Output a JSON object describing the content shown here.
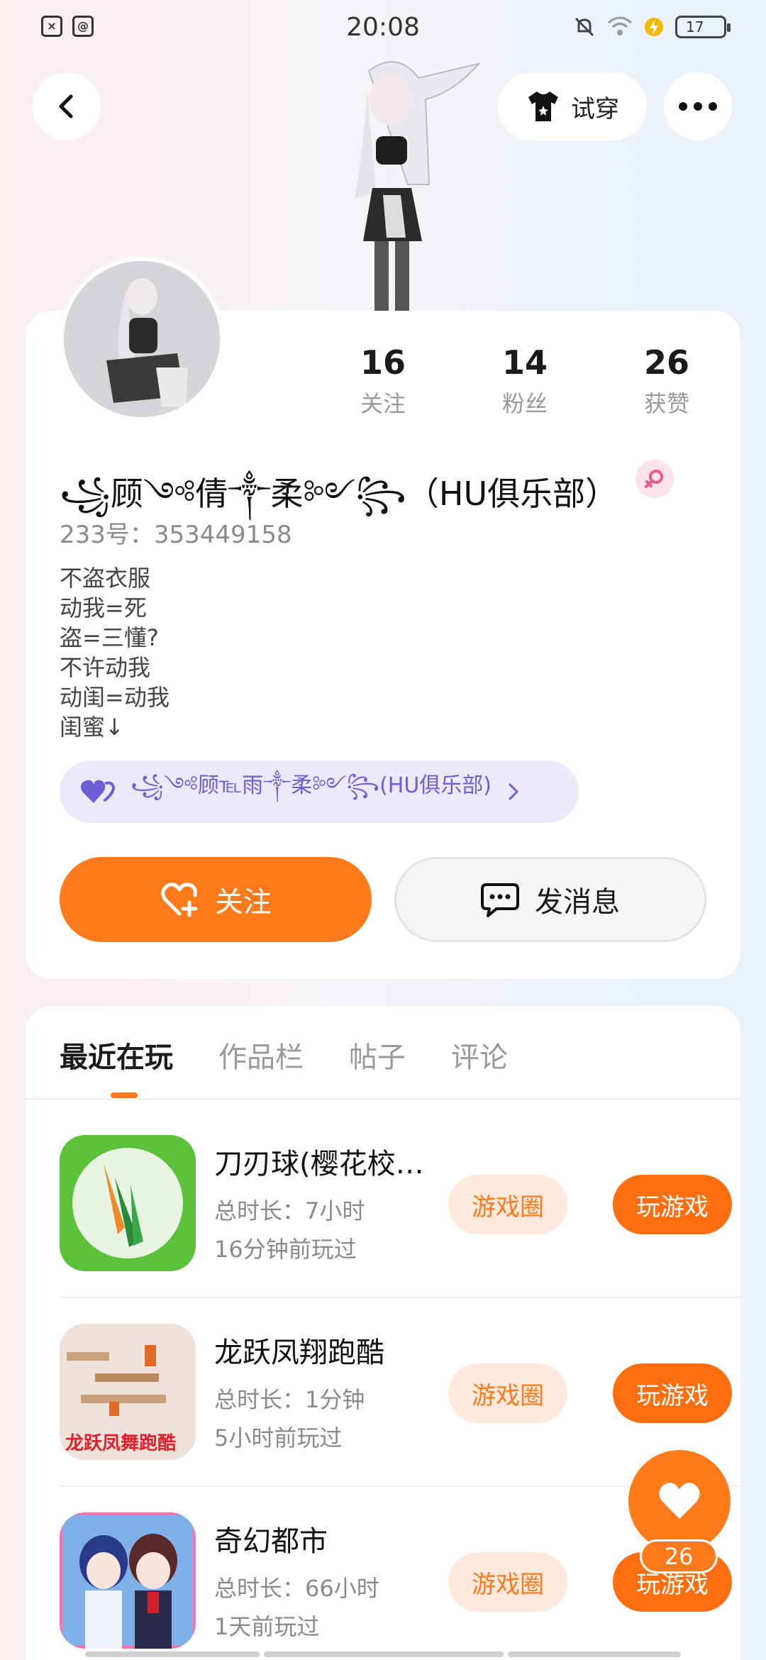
{
  "status_bar": {
    "time": "20:08",
    "battery": "17",
    "left_icon_2": "@"
  },
  "header": {
    "tryon_label": "试穿"
  },
  "profile": {
    "stats": [
      {
        "value": "16",
        "label": "关注"
      },
      {
        "value": "14",
        "label": "粉丝"
      },
      {
        "value": "26",
        "label": "获赞"
      }
    ],
    "nickname": "꧁顾༺倩༒柔༻꧂（HU俱乐部）",
    "uid": "233号：353449158",
    "bio": [
      "不盗衣服",
      "动我=死",
      "盗=三懂?",
      "不许动我",
      "动闺=动我",
      "闺蜜↓"
    ],
    "bestie": {
      "name": "꧁༺顾℡雨༒柔༻꧂(HU俱乐部)"
    },
    "follow_label": "关注",
    "message_label": "发消息"
  },
  "tabs": [
    {
      "label": "最近在玩"
    },
    {
      "label": "作品栏"
    },
    {
      "label": "帖子"
    },
    {
      "label": "评论"
    }
  ],
  "games": [
    {
      "title": "刀刃球(樱花校园版)",
      "duration": "总时长：7小时",
      "last_played": "16分钟前玩过",
      "circle_label": "游戏圈",
      "play_label": "玩游戏"
    },
    {
      "title": "龙跃凤翔跑酷",
      "duration": "总时长：1分钟",
      "last_played": "5小时前玩过",
      "circle_label": "游戏圈",
      "play_label": "玩游戏",
      "icon_text": "龙跃凤舞跑酷"
    },
    {
      "title": "奇幻都市",
      "duration": "总时长：66小时",
      "last_played": "1天前玩过",
      "circle_label": "游戏圈",
      "play_label": "玩游戏"
    }
  ],
  "float_like": {
    "count": "26"
  },
  "colors": {
    "accent": "#ff7a1a",
    "bestie_bg": "#ece9fb",
    "bestie_text": "#6c5fd6"
  }
}
